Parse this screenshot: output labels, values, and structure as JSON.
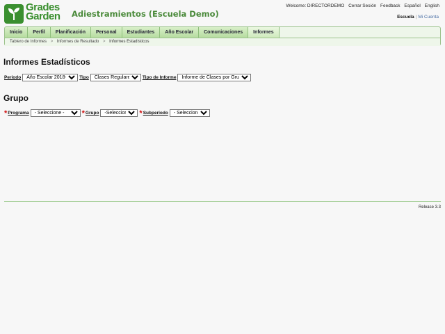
{
  "header": {
    "logo_line1": "Grades",
    "logo_line2": "Garden",
    "school_title": "Adiestramientos (Escuela Demo)",
    "welcome": "Welcome: DIRECTORDEMO",
    "links": [
      "Cerrar Sesión",
      "Feedback",
      "Español",
      "English"
    ],
    "scope_active": "Escuela",
    "scope_separator": "|",
    "scope_other": "Mi Cuenta",
    "brand_color": "#3a8f2f"
  },
  "nav": {
    "tabs": [
      "Inicio",
      "Perfil",
      "Planificación",
      "Personal",
      "Estudiantes",
      "Año Escolar",
      "Comunicaciones",
      "Informes"
    ],
    "active_tab": "Informes",
    "breadcrumb": [
      "Tablero de Informes",
      "Informes de Resultado",
      "Informes Estadísticos"
    ],
    "breadcrumb_arrow": ">"
  },
  "main": {
    "title": "Informes Estadísticos",
    "filters": {
      "periodo_label": "Periodo",
      "periodo_value": "Año Escolar 2018-19",
      "tipo_label": "Tipo",
      "tipo_value": "Clases Regulares",
      "tipo_informe_label": "Tipo de Informe",
      "tipo_informe_value": "Informe de Clases por Grupo"
    },
    "section_title": "Grupo",
    "grupo": {
      "required_mark": "*",
      "programa_label": "Programa",
      "programa_value": "- Seleccione -",
      "grupo_label": "Grupo",
      "grupo_value": "-Seleccione-",
      "subperiodo_label": "Subperiodo",
      "subperiodo_value": "- Seleccione -"
    }
  },
  "footer": {
    "release": "Release 3.3"
  }
}
